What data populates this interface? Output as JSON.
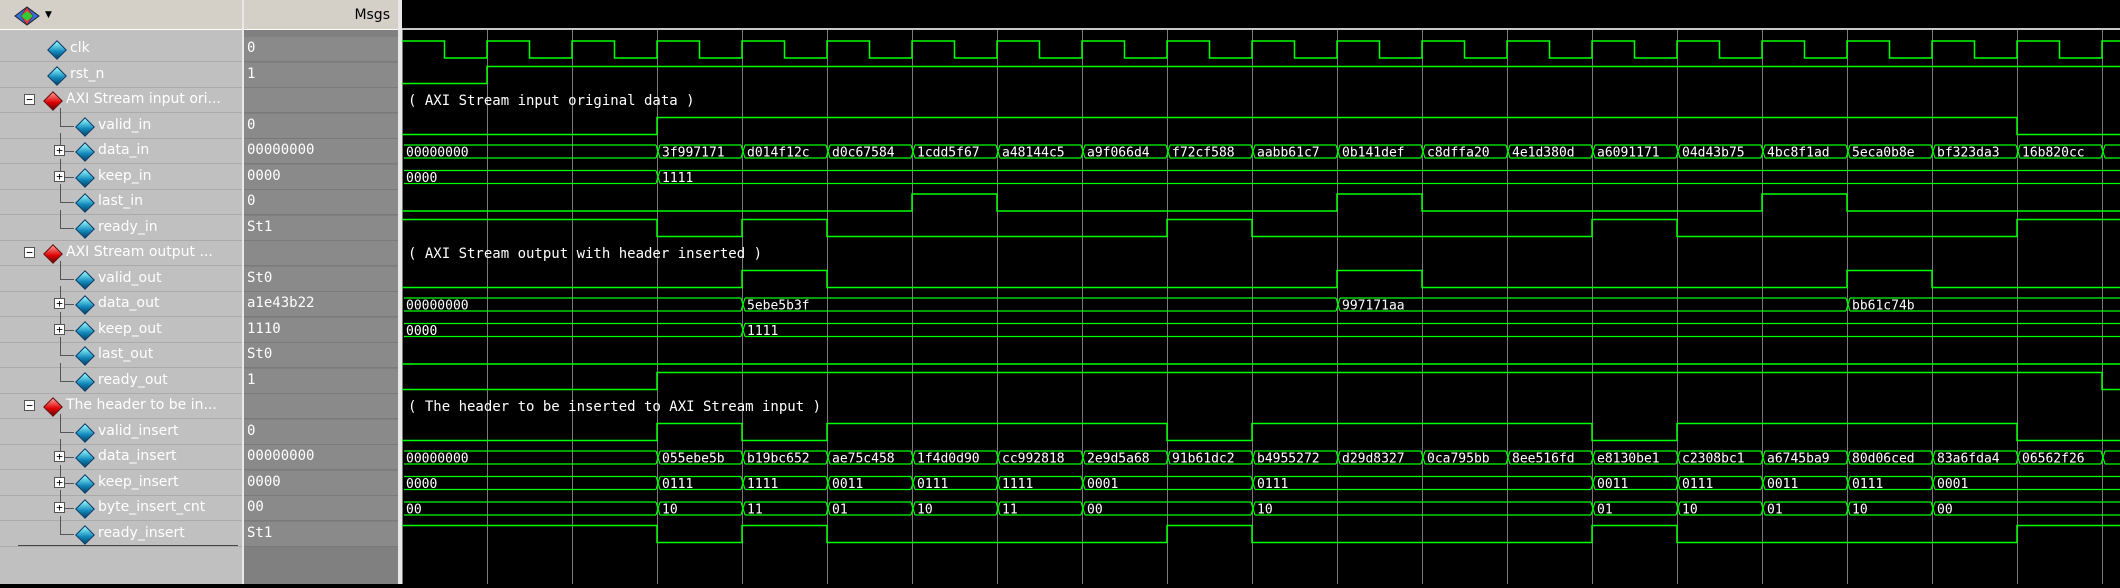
{
  "header": {
    "msgs_label": "Msgs"
  },
  "colors": {
    "wave_green": "#00ff00",
    "background": "#000000",
    "grid": "#7a7a7a",
    "divider_text": "#ffffff"
  },
  "signals": [
    {
      "name": "clk",
      "value": "0",
      "kind": "signal",
      "depth": 1
    },
    {
      "name": "rst_n",
      "value": "1",
      "kind": "signal",
      "depth": 1
    },
    {
      "name": "AXI Stream input ori...",
      "value": "",
      "kind": "group",
      "depth": 0
    },
    {
      "name": "valid_in",
      "value": "0",
      "kind": "signal",
      "depth": 1
    },
    {
      "name": "data_in",
      "value": "00000000",
      "kind": "bus",
      "depth": 1
    },
    {
      "name": "keep_in",
      "value": "0000",
      "kind": "bus",
      "depth": 1
    },
    {
      "name": "last_in",
      "value": "0",
      "kind": "signal",
      "depth": 1
    },
    {
      "name": "ready_in",
      "value": "St1",
      "kind": "signal",
      "depth": 1
    },
    {
      "name": "AXI Stream output ...",
      "value": "",
      "kind": "group",
      "depth": 0
    },
    {
      "name": "valid_out",
      "value": "St0",
      "kind": "signal",
      "depth": 1
    },
    {
      "name": "data_out",
      "value": "a1e43b22",
      "kind": "bus",
      "depth": 1
    },
    {
      "name": "keep_out",
      "value": "1110",
      "kind": "bus",
      "depth": 1
    },
    {
      "name": "last_out",
      "value": "St0",
      "kind": "signal",
      "depth": 1
    },
    {
      "name": "ready_out",
      "value": "1",
      "kind": "signal",
      "depth": 1
    },
    {
      "name": "The header to be in...",
      "value": "",
      "kind": "group",
      "depth": 0
    },
    {
      "name": "valid_insert",
      "value": "0",
      "kind": "signal",
      "depth": 1
    },
    {
      "name": "data_insert",
      "value": "00000000",
      "kind": "bus",
      "depth": 1
    },
    {
      "name": "keep_insert",
      "value": "0000",
      "kind": "bus",
      "depth": 1
    },
    {
      "name": "byte_insert_cnt",
      "value": "00",
      "kind": "bus",
      "depth": 1
    },
    {
      "name": "ready_insert",
      "value": "St1",
      "kind": "signal",
      "depth": 1
    }
  ],
  "dividers": [
    {
      "row": 2,
      "text": "( AXI Stream input original data )"
    },
    {
      "row": 8,
      "text": "( AXI Stream output with header inserted )"
    },
    {
      "row": 14,
      "text": "( The header to be inserted to AXI Stream input )"
    }
  ],
  "waves": {
    "clk": {
      "type": "clock"
    },
    "rst_n": {
      "type": "digital",
      "initial": 0,
      "edges": [
        1
      ]
    },
    "valid_in": {
      "type": "digital",
      "initial": 0,
      "edges": [
        3,
        19
      ]
    },
    "last_in": {
      "type": "digital",
      "initial": 0,
      "edges": [
        6,
        7,
        11,
        12,
        16,
        17
      ]
    },
    "ready_in": {
      "type": "digital",
      "initial": 1,
      "edges": [
        3,
        4,
        5,
        9,
        10,
        14,
        15,
        19
      ]
    },
    "valid_out": {
      "type": "digital",
      "initial": 0,
      "edges": [
        4,
        5,
        11,
        12,
        17,
        18
      ]
    },
    "last_out": {
      "type": "digital",
      "initial": 0,
      "edges": []
    },
    "ready_out": {
      "type": "digital",
      "initial": 0,
      "edges": [
        3,
        20
      ]
    },
    "valid_insert": {
      "type": "digital",
      "initial": 0,
      "edges": [
        3,
        4,
        5,
        9,
        10,
        14,
        15,
        19
      ]
    },
    "ready_insert": {
      "type": "digital",
      "initial": 1,
      "edges": [
        3,
        4,
        5,
        9,
        10,
        14,
        15,
        19
      ]
    },
    "data_in": {
      "type": "bus",
      "segments": [
        {
          "t": 0,
          "label": "00000000"
        },
        {
          "t": 3,
          "label": "3f997171"
        },
        {
          "t": 4,
          "label": "d014f12c"
        },
        {
          "t": 5,
          "label": "d0c67584"
        },
        {
          "t": 6,
          "label": "1cdd5f67"
        },
        {
          "t": 7,
          "label": "a48144c5"
        },
        {
          "t": 8,
          "label": "a9f066d4"
        },
        {
          "t": 9,
          "label": "f72cf588"
        },
        {
          "t": 10,
          "label": "aabb61c7"
        },
        {
          "t": 11,
          "label": "0b141def"
        },
        {
          "t": 12,
          "label": "c8dffa20"
        },
        {
          "t": 13,
          "label": "4e1d380d"
        },
        {
          "t": 14,
          "label": "a6091171"
        },
        {
          "t": 15,
          "label": "04d43b75"
        },
        {
          "t": 16,
          "label": "4bc8f1ad"
        },
        {
          "t": 17,
          "label": "5eca0b8e"
        },
        {
          "t": 18,
          "label": "bf323da3"
        },
        {
          "t": 19,
          "label": "16b820cc"
        },
        {
          "t": 20,
          "label": ""
        }
      ]
    },
    "keep_in": {
      "type": "bus",
      "segments": [
        {
          "t": 0,
          "label": "0000"
        },
        {
          "t": 3,
          "label": "1111"
        }
      ]
    },
    "data_out": {
      "type": "bus",
      "segments": [
        {
          "t": 0,
          "label": "00000000"
        },
        {
          "t": 4,
          "label": "5ebe5b3f"
        },
        {
          "t": 11,
          "label": "997171aa"
        },
        {
          "t": 17,
          "label": "bb61c74b"
        }
      ]
    },
    "keep_out": {
      "type": "bus",
      "segments": [
        {
          "t": 0,
          "label": "0000"
        },
        {
          "t": 4,
          "label": "1111"
        }
      ]
    },
    "data_insert": {
      "type": "bus",
      "segments": [
        {
          "t": 0,
          "label": "00000000"
        },
        {
          "t": 3,
          "label": "055ebe5b"
        },
        {
          "t": 4,
          "label": "b19bc652"
        },
        {
          "t": 5,
          "label": "ae75c458"
        },
        {
          "t": 6,
          "label": "1f4d0d90"
        },
        {
          "t": 7,
          "label": "cc992818"
        },
        {
          "t": 8,
          "label": "2e9d5a68"
        },
        {
          "t": 9,
          "label": "91b61dc2"
        },
        {
          "t": 10,
          "label": "b4955272"
        },
        {
          "t": 11,
          "label": "d29d8327"
        },
        {
          "t": 12,
          "label": "0ca795bb"
        },
        {
          "t": 13,
          "label": "8ee516fd"
        },
        {
          "t": 14,
          "label": "e8130be1"
        },
        {
          "t": 15,
          "label": "c2308bc1"
        },
        {
          "t": 16,
          "label": "a6745ba9"
        },
        {
          "t": 17,
          "label": "80d06ced"
        },
        {
          "t": 18,
          "label": "83a6fda4"
        },
        {
          "t": 19,
          "label": "06562f26"
        },
        {
          "t": 20,
          "label": ""
        }
      ]
    },
    "keep_insert": {
      "type": "bus",
      "segments": [
        {
          "t": 0,
          "label": "0000"
        },
        {
          "t": 3,
          "label": "0111"
        },
        {
          "t": 4,
          "label": "1111"
        },
        {
          "t": 5,
          "label": "0011"
        },
        {
          "t": 6,
          "label": "0111"
        },
        {
          "t": 7,
          "label": "1111"
        },
        {
          "t": 8,
          "label": "0001"
        },
        {
          "t": 10,
          "label": "0111"
        },
        {
          "t": 14,
          "label": "0011"
        },
        {
          "t": 15,
          "label": "0111"
        },
        {
          "t": 16,
          "label": "0011"
        },
        {
          "t": 17,
          "label": "0111"
        },
        {
          "t": 18,
          "label": "0001"
        }
      ]
    },
    "byte_insert_cnt": {
      "type": "bus",
      "segments": [
        {
          "t": 0,
          "label": "00"
        },
        {
          "t": 3,
          "label": "10"
        },
        {
          "t": 4,
          "label": "11"
        },
        {
          "t": 5,
          "label": "01"
        },
        {
          "t": 6,
          "label": "10"
        },
        {
          "t": 7,
          "label": "11"
        },
        {
          "t": 8,
          "label": "00"
        },
        {
          "t": 10,
          "label": "10"
        },
        {
          "t": 14,
          "label": "01"
        },
        {
          "t": 15,
          "label": "10"
        },
        {
          "t": 16,
          "label": "01"
        },
        {
          "t": 17,
          "label": "10"
        },
        {
          "t": 18,
          "label": "00"
        }
      ]
    }
  }
}
